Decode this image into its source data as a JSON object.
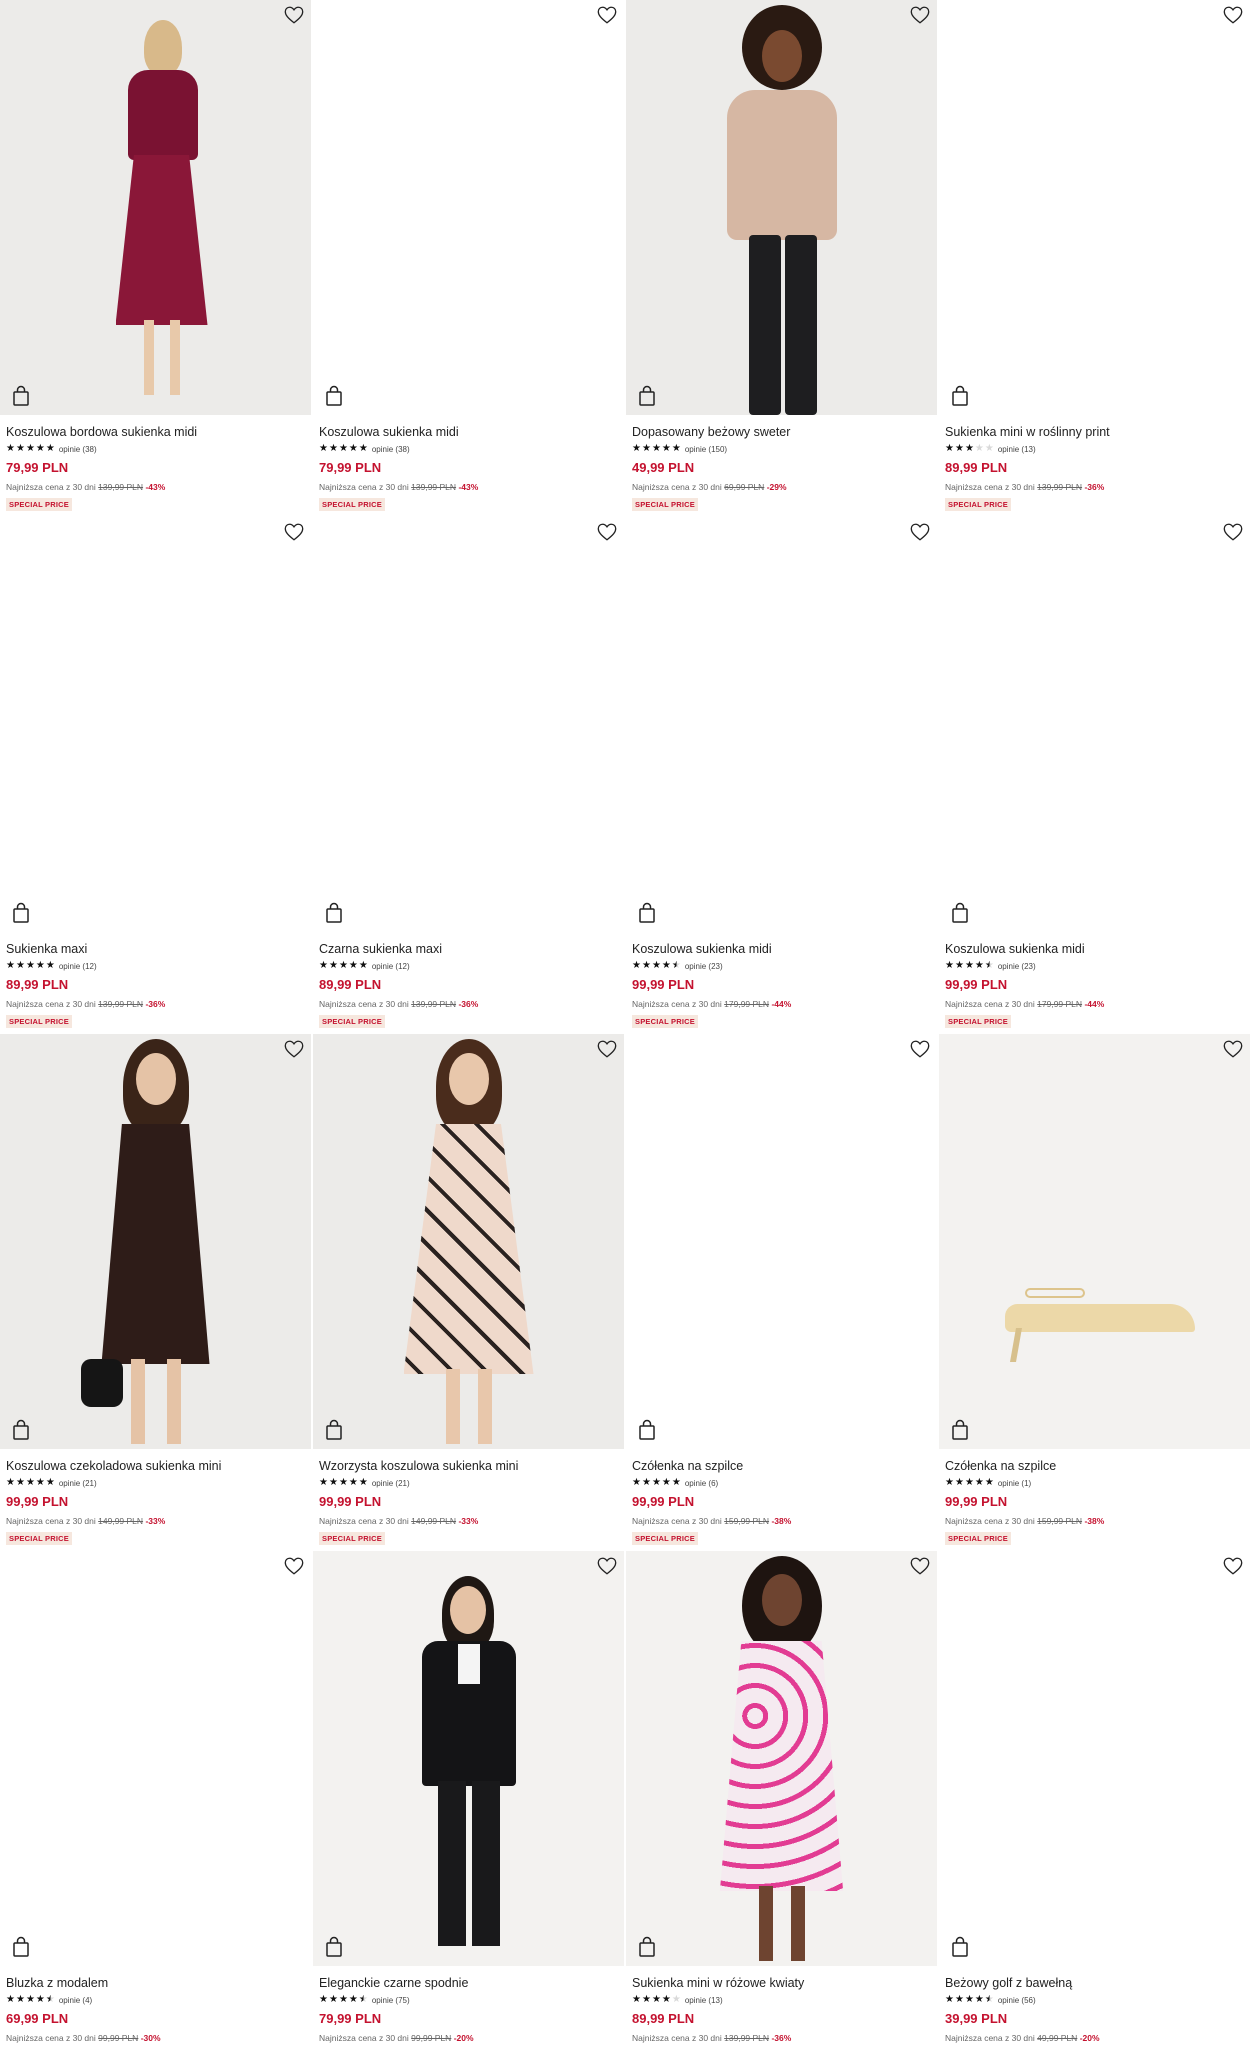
{
  "products": [
    {
      "name": "Koszulowa bordowa sukienka midi",
      "stars": 5,
      "reviews": "opinie (38)",
      "price": "79,99 PLN",
      "lowest_label": "Najniższa cena z 30 dni",
      "old_price": "139,99 PLN",
      "discount": "-43%",
      "badge": "SPECIAL PRICE",
      "image": "woman-burgundy-floral-dress"
    },
    {
      "name": "Koszulowa sukienka midi",
      "stars": 5,
      "reviews": "opinie (38)",
      "price": "79,99 PLN",
      "lowest_label": "Najniższa cena z 30 dni",
      "old_price": "139,99 PLN",
      "discount": "-43%",
      "badge": "SPECIAL PRICE",
      "image": ""
    },
    {
      "name": "Dopasowany beżowy sweter",
      "stars": 5,
      "reviews": "opinie (150)",
      "price": "49,99 PLN",
      "lowest_label": "Najniższa cena z 30 dni",
      "old_price": "69,99 PLN",
      "discount": "-29%",
      "badge": "SPECIAL PRICE",
      "image": "woman-beige-sweater"
    },
    {
      "name": "Sukienka mini w roślinny print",
      "stars": 3,
      "reviews": "opinie (13)",
      "price": "89,99 PLN",
      "lowest_label": "Najniższa cena z 30 dni",
      "old_price": "139,99 PLN",
      "discount": "-36%",
      "badge": "SPECIAL PRICE",
      "image": ""
    },
    {
      "name": "Sukienka maxi",
      "stars": 5,
      "reviews": "opinie (12)",
      "price": "89,99 PLN",
      "lowest_label": "Najniższa cena z 30 dni",
      "old_price": "139,99 PLN",
      "discount": "-36%",
      "badge": "SPECIAL PRICE",
      "image": ""
    },
    {
      "name": "Czarna sukienka maxi",
      "stars": 5,
      "reviews": "opinie (12)",
      "price": "89,99 PLN",
      "lowest_label": "Najniższa cena z 30 dni",
      "old_price": "139,99 PLN",
      "discount": "-36%",
      "badge": "SPECIAL PRICE",
      "image": ""
    },
    {
      "name": "Koszulowa sukienka midi",
      "stars": 4.5,
      "reviews": "opinie (23)",
      "price": "99,99 PLN",
      "lowest_label": "Najniższa cena z 30 dni",
      "old_price": "179,99 PLN",
      "discount": "-44%",
      "badge": "SPECIAL PRICE",
      "image": ""
    },
    {
      "name": "Koszulowa sukienka midi",
      "stars": 4.5,
      "reviews": "opinie (23)",
      "price": "99,99 PLN",
      "lowest_label": "Najniższa cena z 30 dni",
      "old_price": "179,99 PLN",
      "discount": "-44%",
      "badge": "SPECIAL PRICE",
      "image": ""
    },
    {
      "name": "Koszulowa czekoladowa sukienka mini",
      "stars": 5,
      "reviews": "opinie (21)",
      "price": "99,99 PLN",
      "lowest_label": "Najniższa cena z 30 dni",
      "old_price": "149,99 PLN",
      "discount": "-33%",
      "badge": "SPECIAL PRICE",
      "image": "woman-chocolate-mini-dress"
    },
    {
      "name": "Wzorzysta koszulowa sukienka mini",
      "stars": 5,
      "reviews": "opinie (21)",
      "price": "99,99 PLN",
      "lowest_label": "Najniższa cena z 30 dni",
      "old_price": "149,99 PLN",
      "discount": "-33%",
      "badge": "SPECIAL PRICE",
      "image": "woman-patterned-mini-dress"
    },
    {
      "name": "Czółenka na szpilce",
      "stars": 5,
      "reviews": "opinie (6)",
      "price": "99,99 PLN",
      "lowest_label": "Najniższa cena z 30 dni",
      "old_price": "159,99 PLN",
      "discount": "-38%",
      "badge": "SPECIAL PRICE",
      "image": ""
    },
    {
      "name": "Czółenka na szpilce",
      "stars": 5,
      "reviews": "opinie (1)",
      "price": "99,99 PLN",
      "lowest_label": "Najniższa cena z 30 dni",
      "old_price": "159,99 PLN",
      "discount": "-38%",
      "badge": "SPECIAL PRICE",
      "image": "beige-slingback-heel"
    },
    {
      "name": "Bluzka z modalem",
      "stars": 4.5,
      "reviews": "opinie (4)",
      "price": "69,99 PLN",
      "lowest_label": "Najniższa cena z 30 dni",
      "old_price": "99,99 PLN",
      "discount": "-30%",
      "badge": "",
      "image": ""
    },
    {
      "name": "Eleganckie czarne spodnie",
      "stars": 4.5,
      "reviews": "opinie (75)",
      "price": "79,99 PLN",
      "lowest_label": "Najniższa cena z 30 dni",
      "old_price": "99,99 PLN",
      "discount": "-20%",
      "badge": "",
      "image": "woman-black-suit"
    },
    {
      "name": "Sukienka mini w różowe kwiaty",
      "stars": 4,
      "reviews": "opinie (13)",
      "price": "89,99 PLN",
      "lowest_label": "Najniższa cena z 30 dni",
      "old_price": "139,99 PLN",
      "discount": "-36%",
      "badge": "",
      "image": "woman-pink-floral-dress"
    },
    {
      "name": "Beżowy golf z bawełną",
      "stars": 4.5,
      "reviews": "opinie (56)",
      "price": "39,99 PLN",
      "lowest_label": "Najniższa cena z 30 dni",
      "old_price": "49,99 PLN",
      "discount": "-20%",
      "badge": "",
      "image": ""
    }
  ],
  "icons": {
    "favorite": "heart-outline-icon",
    "add_to_cart": "shopping-bag-icon",
    "rating": "star-icon"
  },
  "colors": {
    "price": "#c4122f",
    "badge_bg": "#f6e7de",
    "text": "#222222"
  }
}
